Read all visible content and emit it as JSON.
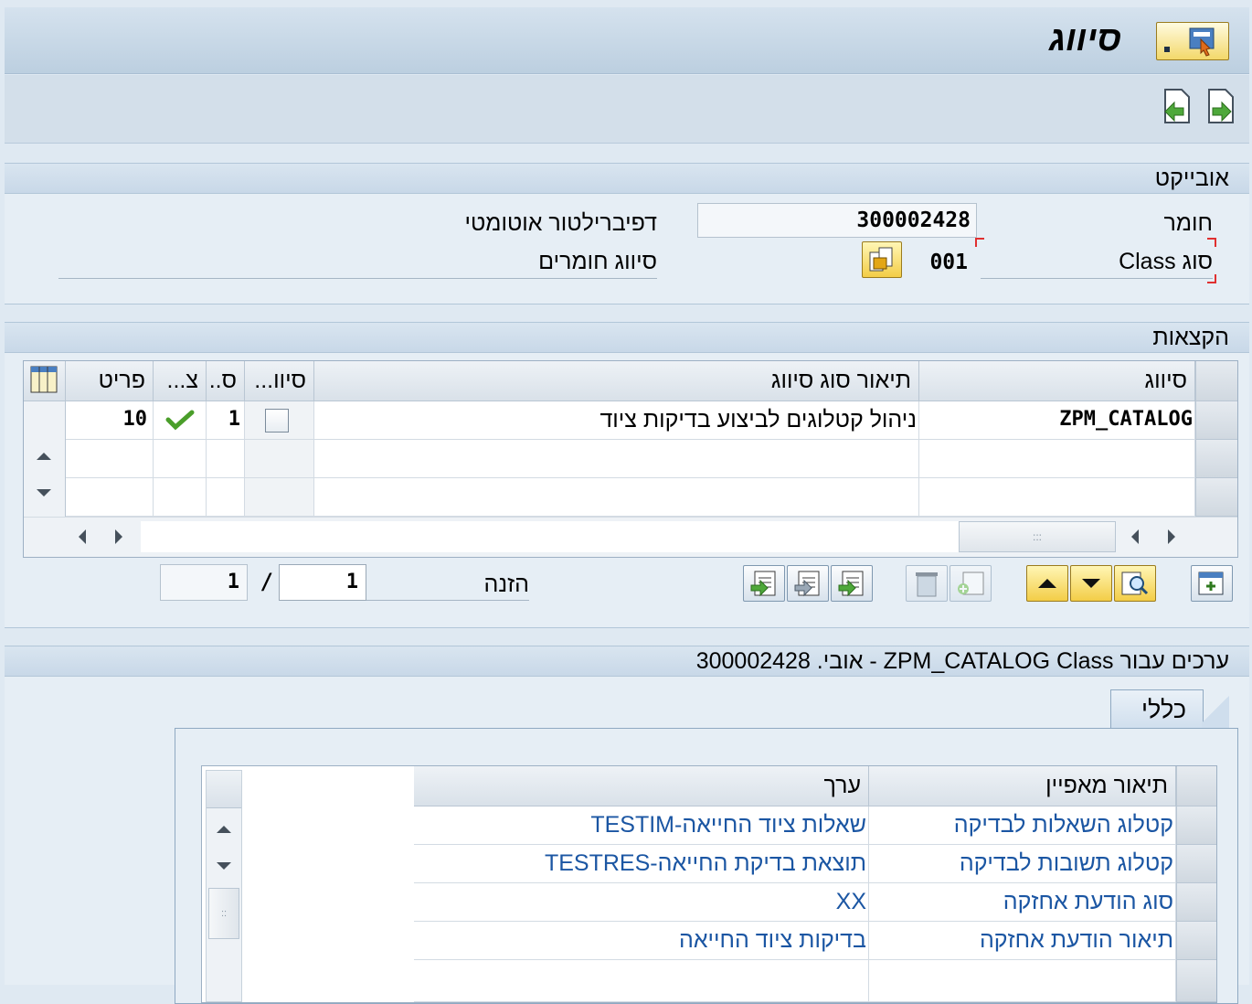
{
  "title": "סיווג",
  "object_section": {
    "header": "אובייקט",
    "material_label": "חומר",
    "material_value": "300002428",
    "material_desc": "דפיברילטור אוטומטי",
    "class_type_label": "סוג Class",
    "class_type_value": "001",
    "class_type_desc": "סיווג חומרים"
  },
  "assignments": {
    "header": "הקצאות",
    "columns": [
      "סיווג",
      "תיאור סוג סיווג",
      "סיוו...",
      "ס..",
      "צ...",
      "פריט"
    ],
    "rows": [
      {
        "class": "ZPM_CATALOG",
        "desc": "ניהול קטלוגים לביצוע בדיקות ציוד",
        "status": "1",
        "item": "10"
      }
    ],
    "entry_label": "הזנה",
    "entry_current": "1",
    "entry_separator": "/",
    "entry_total": "1"
  },
  "values": {
    "header": "ערכים עבור ZPM_CATALOG Class - אובי. 300002428",
    "tab_label": "כללי",
    "columns": [
      "תיאור מאפיין",
      "ערך"
    ],
    "rows": [
      {
        "char": "קטלוג השאלות לבדיקה",
        "value": "TESTIM-שאלות ציוד החייאה"
      },
      {
        "char": "קטלוג תשובות לבדיקה",
        "value": "TESTRES-תוצאת בדיקת החייאה"
      },
      {
        "char": "סוג הודעת אחזקה",
        "value": "XX"
      },
      {
        "char": "תיאור הודעת אחזקה",
        "value": "בדיקות ציוד החייאה"
      }
    ]
  },
  "colors": {
    "link": "#1b56a3",
    "accent_yellow": "#f3cd47",
    "check_green": "#4a9e2a"
  }
}
